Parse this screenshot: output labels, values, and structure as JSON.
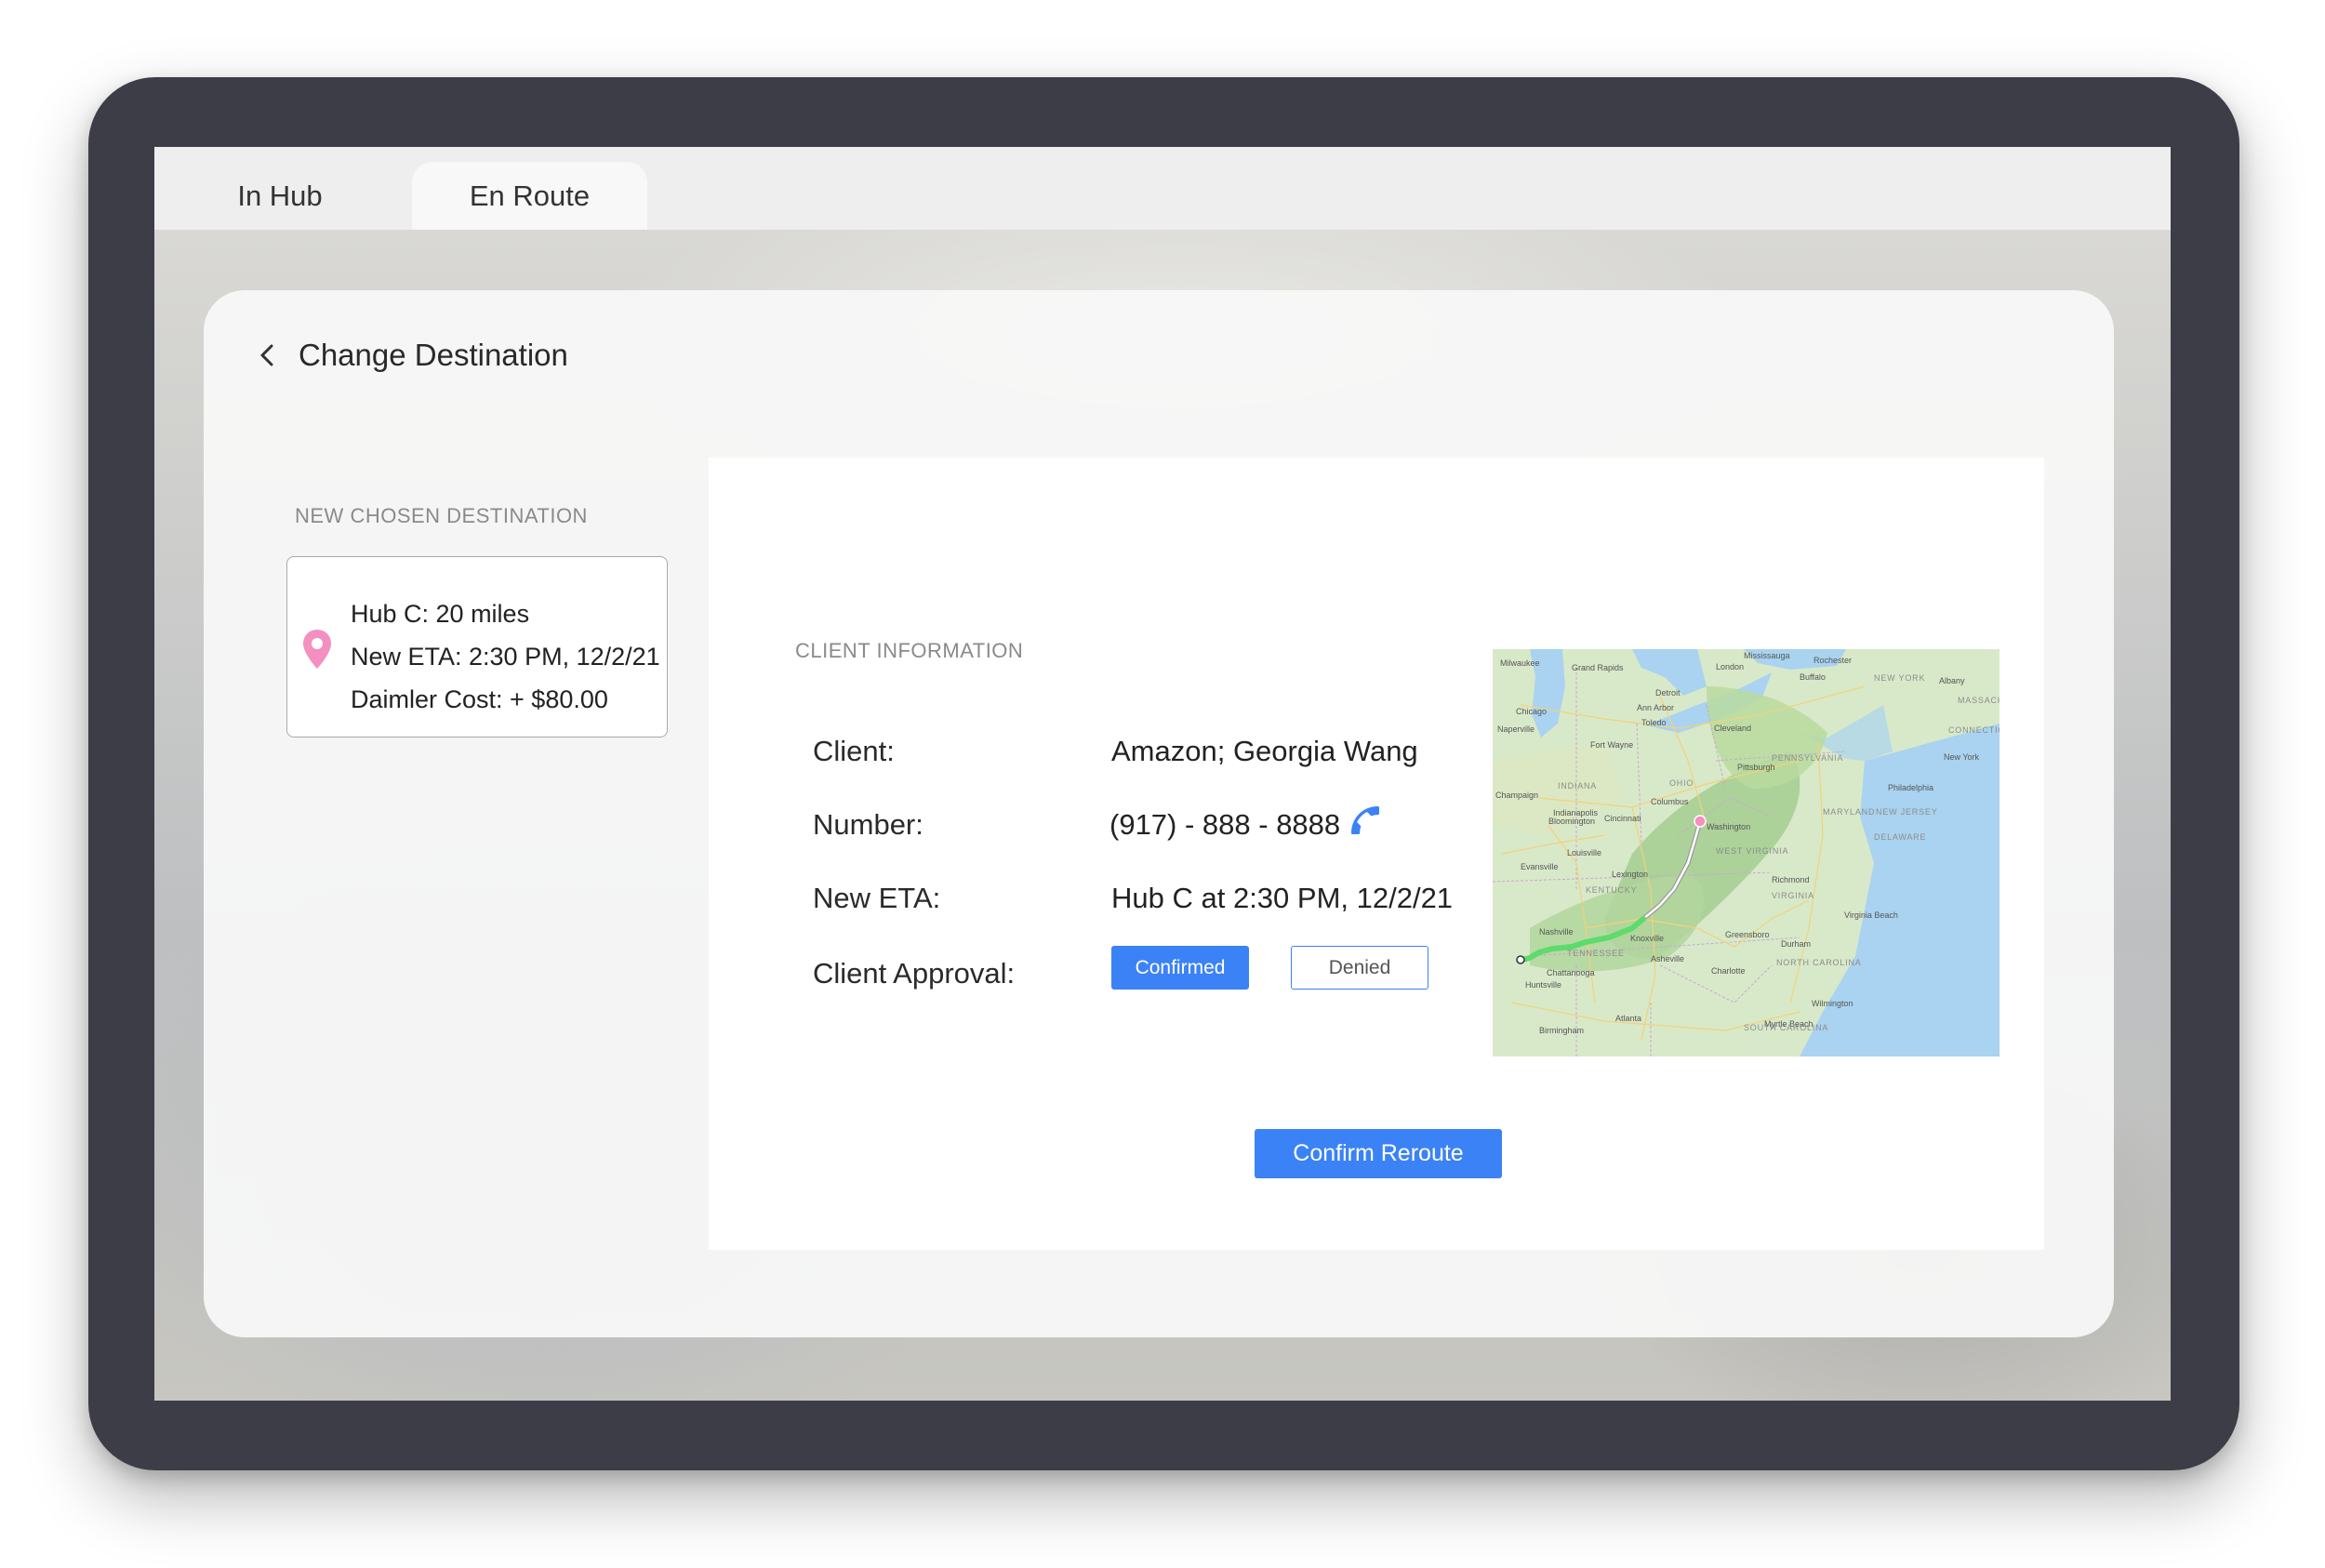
{
  "tabs": [
    {
      "label": "In Hub",
      "active": false
    },
    {
      "label": "En Route",
      "active": true
    }
  ],
  "header": {
    "title": "Change Destination"
  },
  "destination": {
    "section_label": "NEW CHOSEN DESTINATION",
    "lines": [
      "Hub C: 20 miles",
      "New ETA: 2:30 PM, 12/2/21",
      "Daimler Cost: + $80.00"
    ]
  },
  "client": {
    "section_label": "CLIENT INFORMATION",
    "client_label": "Client:",
    "client_value": "Amazon; Georgia Wang",
    "number_label": "Number:",
    "number_value": "(917) - 888 - 8888",
    "eta_label": "New ETA:",
    "eta_value": "Hub C at 2:30 PM, 12/2/21",
    "approval_label": "Client Approval:",
    "confirmed_label": "Confirmed",
    "denied_label": "Denied"
  },
  "map": {
    "cities": [
      "Milwaukee",
      "Grand Rapids",
      "Mississauga",
      "Rochester",
      "Chicago",
      "Detroit",
      "Ann Arbor",
      "Buffalo",
      "Albany",
      "Naperville",
      "Toledo",
      "Cleveland",
      "Fort Wayne",
      "Pittsburgh",
      "New York",
      "Indianapolis",
      "Columbus",
      "Cincinnati",
      "Philadelphia",
      "Bloomington",
      "Champaign",
      "Washington",
      "Louisville",
      "Lexington",
      "Evansville",
      "Richmond",
      "Nashville",
      "Knoxville",
      "Greensboro",
      "Durham",
      "Virginia Beach",
      "Asheville",
      "Charlotte",
      "Chattanooga",
      "Huntsville",
      "Atlanta",
      "Wilmington",
      "Birmingham",
      "Myrtle Beach",
      "London"
    ],
    "states": [
      "NEW YORK",
      "MASSACHU",
      "CONNECTIC",
      "INDIANA",
      "OHIO",
      "PENNSYLVANIA",
      "MARYLAND",
      "NEW JERSEY",
      "DELAWARE",
      "WEST VIRGINIA",
      "KENTUCKY",
      "VIRGINIA",
      "NORTH CAROLINA",
      "SOUTH CAROLINA",
      "TENNESSEE"
    ]
  },
  "actions": {
    "confirm_reroute": "Confirm Reroute"
  },
  "colors": {
    "accent": "#3b82f6",
    "route": "#5ddb6c",
    "pin": "#f48fc1"
  }
}
